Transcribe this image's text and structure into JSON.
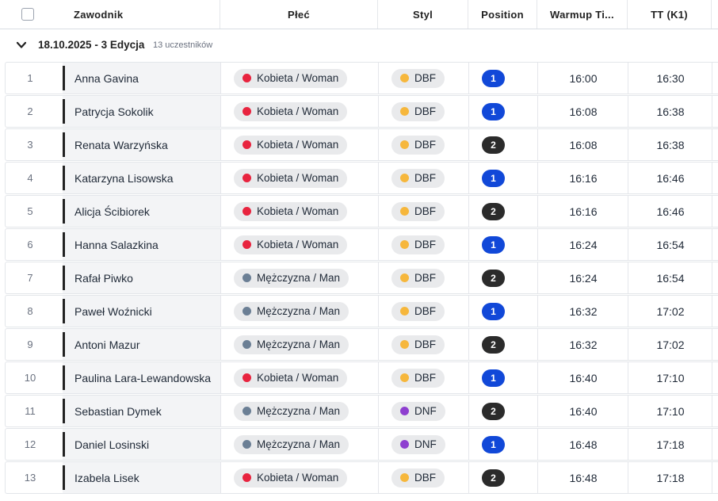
{
  "colors": {
    "woman": "#e8243f",
    "man": "#6b7f95",
    "dbf": "#f6b73c",
    "dnf": "#8e3fd0",
    "position_1": "#1148d8",
    "position_2": "#2b2b2b"
  },
  "header": {
    "select_all_icon": "checkbox-icon",
    "zawodnik": "Zawodnik",
    "plec": "Płeć",
    "styl": "Styl",
    "position": "Position",
    "warmup": "Warmup Ti...",
    "tt": "TT (K1)"
  },
  "group": {
    "toggle_icon": "chevron-down-icon",
    "title": "18.10.2025 - 3 Edycja",
    "count": "13 uczestników"
  },
  "rows": [
    {
      "num": "1",
      "name": "Anna Gavina",
      "gender": "Kobieta / Woman",
      "gender_key": "woman",
      "style": "DBF",
      "style_key": "dbf",
      "position": "1",
      "warmup": "16:00",
      "tt": "16:30"
    },
    {
      "num": "2",
      "name": "Patrycja Sokolik",
      "gender": "Kobieta / Woman",
      "gender_key": "woman",
      "style": "DBF",
      "style_key": "dbf",
      "position": "1",
      "warmup": "16:08",
      "tt": "16:38"
    },
    {
      "num": "3",
      "name": "Renata Warzyńska",
      "gender": "Kobieta / Woman",
      "gender_key": "woman",
      "style": "DBF",
      "style_key": "dbf",
      "position": "2",
      "warmup": "16:08",
      "tt": "16:38"
    },
    {
      "num": "4",
      "name": "Katarzyna Lisowska",
      "gender": "Kobieta / Woman",
      "gender_key": "woman",
      "style": "DBF",
      "style_key": "dbf",
      "position": "1",
      "warmup": "16:16",
      "tt": "16:46"
    },
    {
      "num": "5",
      "name": "Alicja Ścibiorek",
      "gender": "Kobieta / Woman",
      "gender_key": "woman",
      "style": "DBF",
      "style_key": "dbf",
      "position": "2",
      "warmup": "16:16",
      "tt": "16:46"
    },
    {
      "num": "6",
      "name": "Hanna Salazkina",
      "gender": "Kobieta / Woman",
      "gender_key": "woman",
      "style": "DBF",
      "style_key": "dbf",
      "position": "1",
      "warmup": "16:24",
      "tt": "16:54"
    },
    {
      "num": "7",
      "name": "Rafał Piwko",
      "gender": "Mężczyzna / Man",
      "gender_key": "man",
      "style": "DBF",
      "style_key": "dbf",
      "position": "2",
      "warmup": "16:24",
      "tt": "16:54"
    },
    {
      "num": "8",
      "name": "Paweł Woźnicki",
      "gender": "Mężczyzna / Man",
      "gender_key": "man",
      "style": "DBF",
      "style_key": "dbf",
      "position": "1",
      "warmup": "16:32",
      "tt": "17:02"
    },
    {
      "num": "9",
      "name": "Antoni Mazur",
      "gender": "Mężczyzna / Man",
      "gender_key": "man",
      "style": "DBF",
      "style_key": "dbf",
      "position": "2",
      "warmup": "16:32",
      "tt": "17:02"
    },
    {
      "num": "10",
      "name": "Paulina Lara-Lewandowska",
      "gender": "Kobieta / Woman",
      "gender_key": "woman",
      "style": "DBF",
      "style_key": "dbf",
      "position": "1",
      "warmup": "16:40",
      "tt": "17:10"
    },
    {
      "num": "11",
      "name": "Sebastian Dymek",
      "gender": "Mężczyzna / Man",
      "gender_key": "man",
      "style": "DNF",
      "style_key": "dnf",
      "position": "2",
      "warmup": "16:40",
      "tt": "17:10"
    },
    {
      "num": "12",
      "name": "Daniel Losinski",
      "gender": "Mężczyzna / Man",
      "gender_key": "man",
      "style": "DNF",
      "style_key": "dnf",
      "position": "1",
      "warmup": "16:48",
      "tt": "17:18"
    },
    {
      "num": "13",
      "name": "Izabela Lisek",
      "gender": "Kobieta / Woman",
      "gender_key": "woman",
      "style": "DBF",
      "style_key": "dbf",
      "position": "2",
      "warmup": "16:48",
      "tt": "17:18"
    }
  ]
}
